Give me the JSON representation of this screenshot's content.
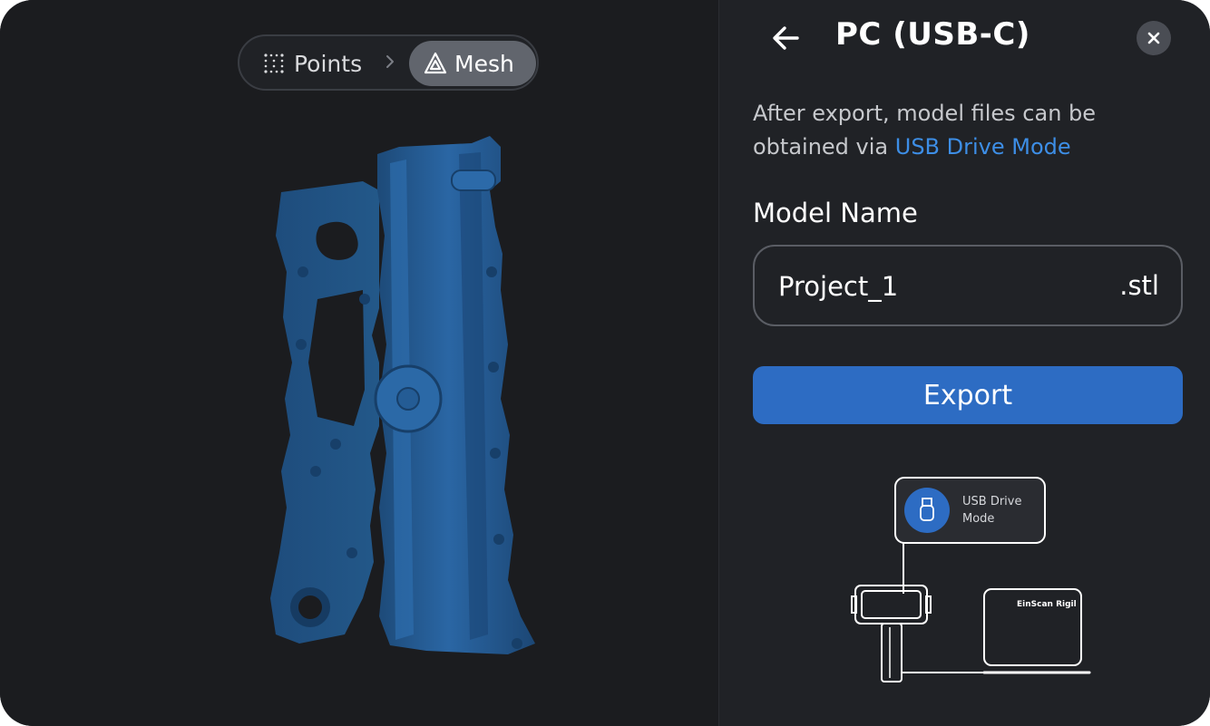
{
  "viewport": {
    "mode_switch": {
      "points_label": "Points",
      "mesh_label": "Mesh",
      "active": "Mesh"
    },
    "model_color": "#23578c"
  },
  "panel": {
    "title": "PC (USB-C)",
    "description_prefix": "After export, model files can be obtained via ",
    "description_link": "USB Drive Mode",
    "model_name_label": "Model Name",
    "model_name_value": "Project_1",
    "file_extension": ".stl",
    "export_label": "Export",
    "illustration": {
      "badge_label_line1": "USB Drive",
      "badge_label_line2": "Mode",
      "device_brand": "EinScan Rigil"
    }
  },
  "colors": {
    "background": "#1b1c1f",
    "panel": "#202226",
    "accent": "#2d6cc3",
    "link": "#3d8ee6"
  }
}
